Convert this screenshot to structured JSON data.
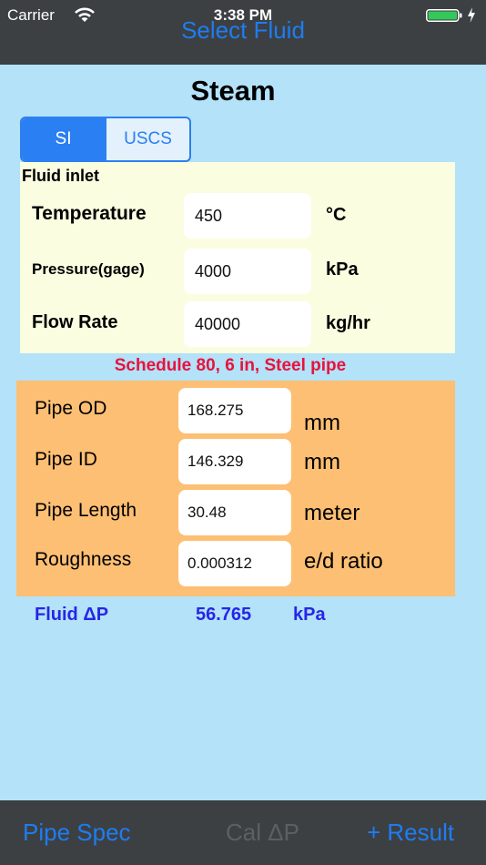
{
  "status_bar": {
    "carrier": "Carrier",
    "time": "3:38 PM",
    "battery_color": "#34c759"
  },
  "nav": {
    "title": "Select Fluid"
  },
  "fluid_name": "Steam",
  "units_toggle": {
    "options": [
      "SI",
      "USCS"
    ],
    "selected": "SI"
  },
  "fluid_inlet": {
    "heading": "Fluid inlet",
    "rows": [
      {
        "label": "Temperature",
        "value": "450",
        "unit": "°C"
      },
      {
        "label": "Pressure(gage)",
        "value": "4000",
        "unit": "kPa"
      },
      {
        "label": "Flow Rate",
        "value": "40000",
        "unit": "kg/hr"
      }
    ]
  },
  "pipe_spec_caption": "Schedule 80, 6 in, Steel pipe",
  "pipe": {
    "rows": [
      {
        "label": "Pipe OD",
        "value": "168.275",
        "unit": "mm"
      },
      {
        "label": "Pipe ID",
        "value": "146.329",
        "unit": "mm"
      },
      {
        "label": "Pipe Length",
        "value": "30.48",
        "unit": "meter"
      },
      {
        "label": "Roughness",
        "value": "0.000312",
        "unit": "e/d ratio"
      }
    ]
  },
  "result": {
    "label": "Fluid ΔP",
    "value": "56.765",
    "unit": "kPa"
  },
  "toolbar": {
    "left": "Pipe Spec",
    "center": "Cal ΔP",
    "right": "+ Result"
  },
  "colors": {
    "accent": "#1f7cf1",
    "background": "#b3e2f9",
    "inlet_panel": "#fbfde0",
    "pipe_panel": "#fdbf73",
    "caption": "#e8133c",
    "result": "#2626e6"
  }
}
